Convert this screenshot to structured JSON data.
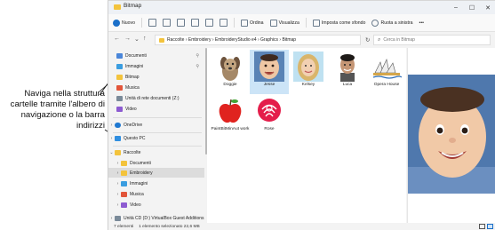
{
  "annotation": {
    "text": "Naviga nella struttura cartelle tramite l'albero di navigazione o la barra indirizzi"
  },
  "window": {
    "title": "Bitmap",
    "controls": [
      "–",
      "☐",
      "✕"
    ]
  },
  "toolbar": {
    "new_label": "Nuovo",
    "sort_label": "Ordina",
    "view_label": "Visualizza",
    "set_bg_label": "Imposta come sfondo",
    "rotate_label": "Ruota a sinistra",
    "more_label": "•••"
  },
  "address": {
    "path": "Raccolte  ›  Embroidery  ›  EmbroideryStudio e4  ›  Graphics  ›  Bitmap",
    "search_placeholder": "Cerca in Bitmap"
  },
  "sidebar": {
    "items": [
      {
        "label": "Documenti",
        "icon": "documents-icon",
        "color": "#4a86d9",
        "pinned": true
      },
      {
        "label": "Immagini",
        "icon": "pictures-icon",
        "color": "#3a9de0",
        "pinned": true
      },
      {
        "label": "Bitmap",
        "icon": "folder-icon",
        "color": "#f3c33c",
        "pinned": false
      },
      {
        "label": "Musica",
        "icon": "music-icon",
        "color": "#e2553a",
        "pinned": false
      },
      {
        "label": "Unità di rete documenti (Z:)",
        "icon": "network-drive-icon",
        "color": "#7a8a99",
        "pinned": false
      },
      {
        "label": "Video",
        "icon": "video-icon",
        "color": "#8d5bd1",
        "pinned": false
      },
      {
        "label": "OneDrive",
        "icon": "onedrive-icon",
        "color": "#1f78d1",
        "pinned": false
      },
      {
        "label": "Questo PC",
        "icon": "this-pc-icon",
        "color": "#2f8ee0",
        "pinned": false
      },
      {
        "label": "Raccolte",
        "icon": "libraries-icon",
        "color": "#f3c33c",
        "pinned": false
      },
      {
        "label": "Documenti",
        "icon": "documents-icon",
        "color": "#f3c33c",
        "pinned": false
      },
      {
        "label": "Embroidery",
        "icon": "folder-icon",
        "color": "#f3c33c",
        "pinned": false
      },
      {
        "label": "Immagini",
        "icon": "pictures-icon",
        "color": "#3a9de0",
        "pinned": false
      },
      {
        "label": "Musica",
        "icon": "music-icon",
        "color": "#e2553a",
        "pinned": false
      },
      {
        "label": "Video",
        "icon": "video-icon",
        "color": "#8d5bd1",
        "pinned": false
      },
      {
        "label": "Unità CD (D:) VirtualBox Guest Additions",
        "icon": "cd-drive-icon",
        "color": "#7a8a99",
        "pinned": false
      }
    ]
  },
  "files": [
    {
      "name": "Doggie",
      "icon": "dog-thumbnail"
    },
    {
      "name": "Jesse",
      "icon": "baby-thumbnail"
    },
    {
      "name": "Kelsey",
      "icon": "girl-thumbnail"
    },
    {
      "name": "Luca",
      "icon": "boy-thumbnail"
    },
    {
      "name": "Opera House",
      "icon": "opera-house-thumbnail"
    },
    {
      "name": "PaintBitMinAut work",
      "icon": "apple-thumbnail"
    },
    {
      "name": "Rose",
      "icon": "rose-thumbnail"
    }
  ],
  "status": {
    "count": "7 elementi",
    "selection": "1 elemento selezionato  22,6 MB"
  },
  "colors": {
    "selection": "#cce4f7",
    "accent": "#1a6fc9",
    "folder": "#f3c33c"
  }
}
